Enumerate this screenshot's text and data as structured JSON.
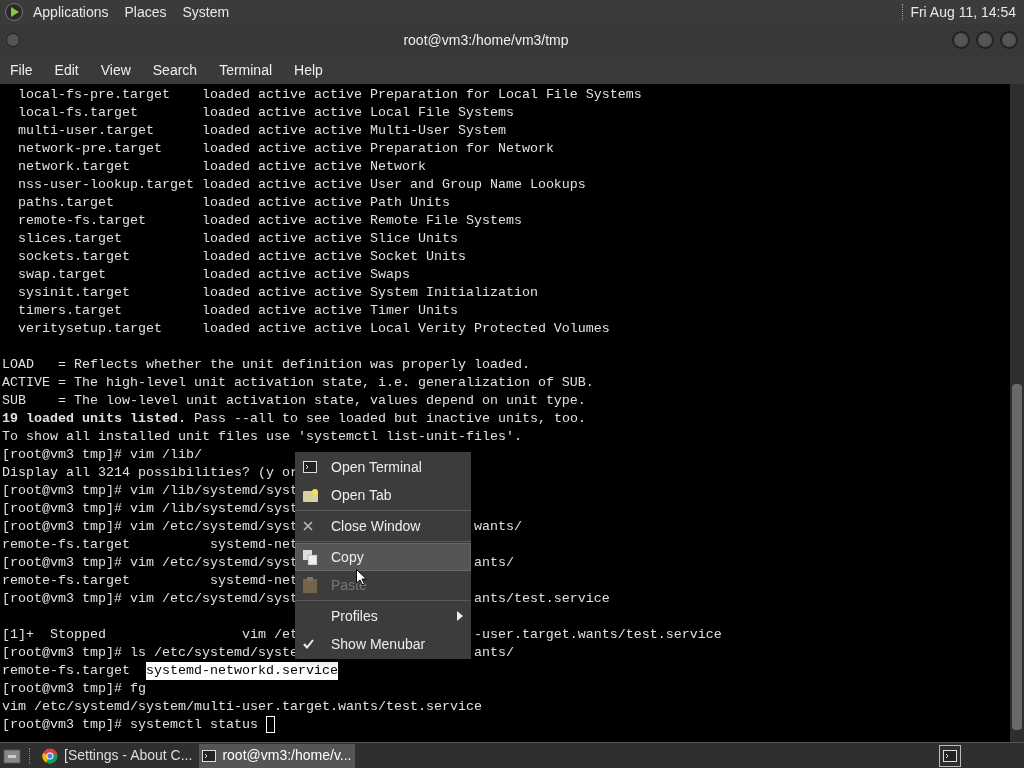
{
  "panel": {
    "menus": [
      "Applications",
      "Places",
      "System"
    ],
    "clock": "Fri Aug 11, 14:54"
  },
  "window": {
    "title": "root@vm3:/home/vm3/tmp",
    "menu_bar": [
      "File",
      "Edit",
      "View",
      "Search",
      "Terminal",
      "Help"
    ]
  },
  "terminal": {
    "blocks": [
      {
        "lines": [
          {
            "text": "  local-fs-pre.target    loaded active active Preparation for Local File Systems"
          },
          {
            "text": "  local-fs.target        loaded active active Local File Systems"
          },
          {
            "text": "  multi-user.target      loaded active active Multi-User System"
          },
          {
            "text": "  network-pre.target     loaded active active Preparation for Network"
          },
          {
            "text": "  network.target         loaded active active Network"
          },
          {
            "text": "  nss-user-lookup.target loaded active active User and Group Name Lookups"
          },
          {
            "text": "  paths.target           loaded active active Path Units"
          },
          {
            "text": "  remote-fs.target       loaded active active Remote File Systems"
          },
          {
            "text": "  slices.target          loaded active active Slice Units"
          },
          {
            "text": "  sockets.target         loaded active active Socket Units"
          },
          {
            "text": "  swap.target            loaded active active Swaps"
          },
          {
            "text": "  sysinit.target         loaded active active System Initialization"
          },
          {
            "text": "  timers.target          loaded active active Timer Units"
          },
          {
            "text": "  veritysetup.target     loaded active active Local Verity Protected Volumes"
          }
        ]
      },
      {
        "lines": [
          {
            "text": "LOAD   = Reflects whether the unit definition was properly loaded."
          },
          {
            "text": "ACTIVE = The high-level unit activation state, i.e. generalization of SUB."
          },
          {
            "text": "SUB    = The low-level unit activation state, values depend on unit type."
          },
          {
            "text": "**19 loaded units listed.** Pass --all to see loaded but inactive units, too."
          },
          {
            "text": "To show all installed unit files use 'systemctl list-unit-files'."
          },
          {
            "text": "[root@vm3 tmp]# vim /lib/"
          },
          {
            "text": "Display all 3214 possibilities? (y or"
          },
          {
            "text": "[root@vm3 tmp]# vim /lib/systemd/syst"
          },
          {
            "text": "[root@vm3 tmp]# vim /lib/systemd/syst"
          },
          {
            "text": "[root@vm3 tmp]# vim /etc/systemd/syst",
            "right": "wants/"
          },
          {
            "text": "remote-fs.target          systemd-net"
          },
          {
            "text": "[root@vm3 tmp]# vim /etc/systemd/syst",
            "right": "ants/"
          },
          {
            "text": "remote-fs.target          systemd-net"
          },
          {
            "text": "[root@vm3 tmp]# vim /etc/systemd/syst",
            "right": "ants/test.service"
          }
        ]
      },
      {
        "lines": [
          {
            "text": "[1]+  Stopped                 vim /et",
            "right": "-user.target.wants/test.service"
          },
          {
            "text": "[root@vm3 tmp]# ls /etc/systemd/syste",
            "right": "ants/"
          },
          {
            "text": "remote-fs.target  ",
            "selection": "systemd-networkd.service"
          },
          {
            "text": "[root@vm3 tmp]# fg"
          },
          {
            "text": "vim /etc/systemd/system/multi-user.target.wants/test.service"
          },
          {
            "text": "[root@vm3 tmp]# systemctl status ",
            "cursor": true
          }
        ]
      }
    ]
  },
  "context_menu": {
    "items": [
      {
        "kind": "item",
        "label": "Open Terminal",
        "selected": false,
        "disabled": false,
        "checked": false,
        "submenu": false
      },
      {
        "kind": "item",
        "label": "Open Tab",
        "selected": false,
        "disabled": false,
        "checked": false,
        "submenu": false
      },
      {
        "kind": "separator"
      },
      {
        "kind": "item",
        "label": "Close Window",
        "selected": false,
        "disabled": false,
        "checked": false,
        "submenu": false
      },
      {
        "kind": "separator"
      },
      {
        "kind": "item",
        "label": "Copy",
        "selected": true,
        "disabled": false,
        "checked": false,
        "submenu": false
      },
      {
        "kind": "item",
        "label": "Paste",
        "selected": false,
        "disabled": true,
        "checked": false,
        "submenu": false
      },
      {
        "kind": "separator"
      },
      {
        "kind": "item",
        "label": "Profiles",
        "selected": false,
        "disabled": false,
        "checked": false,
        "submenu": true
      },
      {
        "kind": "item",
        "label": "Show Menubar",
        "selected": false,
        "disabled": false,
        "checked": true,
        "submenu": false
      }
    ]
  },
  "taskbar": {
    "tasks": [
      {
        "label": "[Settings - About C...",
        "selected": false
      },
      {
        "label": "root@vm3:/home/v...",
        "selected": true
      }
    ]
  }
}
